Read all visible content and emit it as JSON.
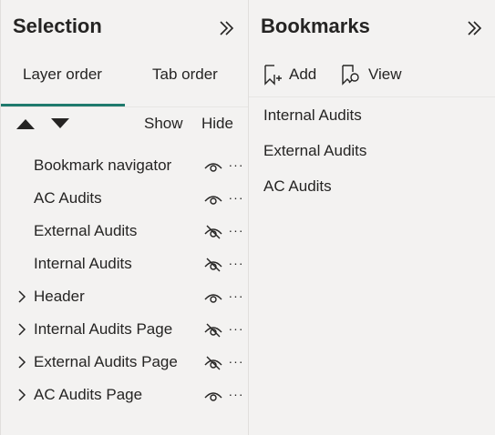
{
  "selection": {
    "title": "Selection",
    "tabs": [
      {
        "label": "Layer order",
        "active": true
      },
      {
        "label": "Tab order",
        "active": false
      }
    ],
    "toolbar": {
      "move_up_icon": "triangle-up-icon",
      "move_down_icon": "triangle-down-icon",
      "show_label": "Show",
      "hide_label": "Hide"
    },
    "layers": [
      {
        "label": "Bookmark navigator",
        "group": false,
        "visible": true
      },
      {
        "label": "AC Audits",
        "group": false,
        "visible": true
      },
      {
        "label": "External Audits",
        "group": false,
        "visible": false
      },
      {
        "label": "Internal Audits",
        "group": false,
        "visible": false
      },
      {
        "label": "Header",
        "group": true,
        "visible": true
      },
      {
        "label": "Internal Audits Page",
        "group": true,
        "visible": false
      },
      {
        "label": "External Audits Page",
        "group": true,
        "visible": false
      },
      {
        "label": "AC Audits Page",
        "group": true,
        "visible": true
      }
    ]
  },
  "bookmarks": {
    "title": "Bookmarks",
    "add_label": "Add",
    "view_label": "View",
    "items": [
      "Internal Audits",
      "External Audits",
      "AC Audits"
    ]
  },
  "colors": {
    "background": "#f3f2f1",
    "accent_underline": "#1f7a6d",
    "text": "#252423"
  }
}
